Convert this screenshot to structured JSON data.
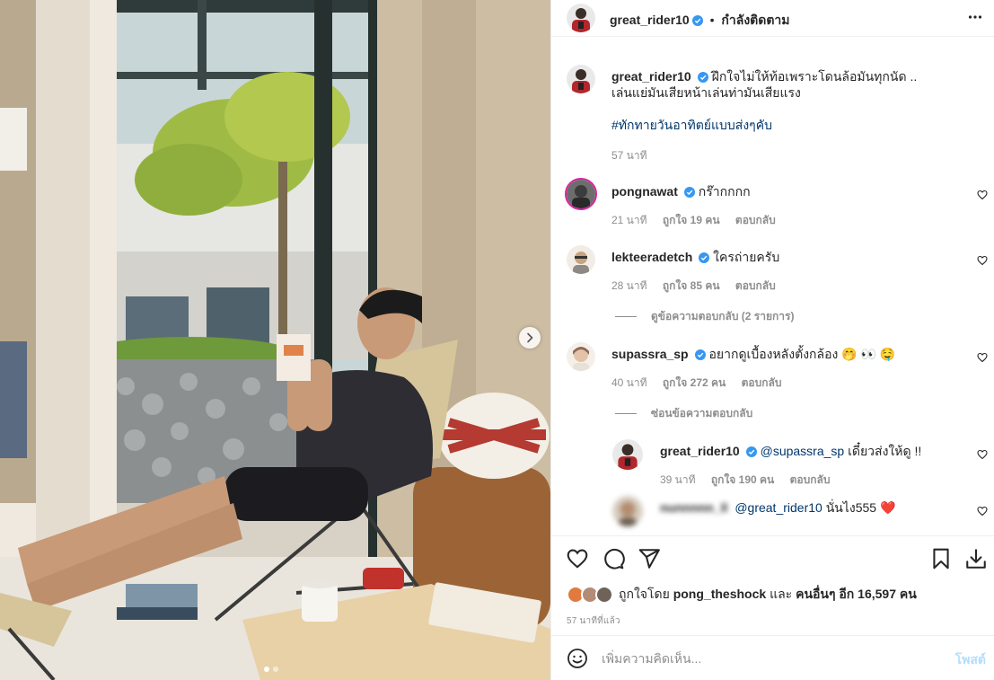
{
  "post": {
    "author": "great_rider10",
    "separator": "•",
    "follow_status": "กำลังติดตาม",
    "caption_line1": "ฝึกใจไม่ให้ท้อเพราะโดนล้อมันทุกนัด ..",
    "caption_line2": "เล่นแย่มันเสียหน้าเล่นท่ามันเสียแรง",
    "hashtag": "#ทักทายวันอาทิตย์แบบส่งๆคับ",
    "caption_time": "57 นาที"
  },
  "comments": [
    {
      "user": "pongnawat",
      "text": "กร๊ากกกก",
      "time": "21 นาที",
      "likes": "ถูกใจ 19 คน",
      "reply": "ตอบกลับ"
    },
    {
      "user": "lekteeradetch",
      "text": "ใครถ่ายครับ",
      "time": "28 นาที",
      "likes": "ถูกใจ 85 คน",
      "reply": "ตอบกลับ",
      "view_replies": "ดูข้อความตอบกลับ (2 รายการ)"
    },
    {
      "user": "supassra_sp",
      "text": "อยากดูเบื้องหลังตั้งกล้อง 🤭 👀 🤤",
      "time": "40 นาที",
      "likes": "ถูกใจ 272 คน",
      "reply": "ตอบกลับ",
      "hide_replies": "ซ่อนข้อความตอบกลับ"
    }
  ],
  "replies": [
    {
      "user": "great_rider10",
      "mention": "@supassra_sp",
      "text": "เดี๋ยวส่งให้ดู !!",
      "time": "39 นาที",
      "likes": "ถูกใจ 190 คน",
      "reply": "ตอบกลับ"
    },
    {
      "user": "nunnnnn_ll",
      "mention": "@great_rider10",
      "text": "นั่นไง555 ❤️"
    }
  ],
  "likes": {
    "prefix": "ถูกใจโดย",
    "first_user": "pong_theshock",
    "conjunction": "และ",
    "others": "คนอื่นๆ อีก 16,597 คน"
  },
  "timestamp": "57 นาทีที่แล้ว",
  "add_comment": {
    "placeholder": "เพิ่มความคิดเห็น...",
    "post_label": "โพสต์"
  },
  "icons": {
    "more": "more-horizontal-icon",
    "like": "heart-icon",
    "comment": "comment-icon",
    "share": "paper-plane-icon",
    "save": "bookmark-icon",
    "download": "download-icon",
    "emoji": "smiley-icon",
    "verified": "verified-badge-icon",
    "next": "chevron-right-icon"
  },
  "colors": {
    "verified": "#3897f0",
    "link": "#00376b",
    "post_button": "#b2dffc",
    "secondary_text": "#8e8e8e"
  },
  "carousel": {
    "slide": 1,
    "slides": 2
  }
}
